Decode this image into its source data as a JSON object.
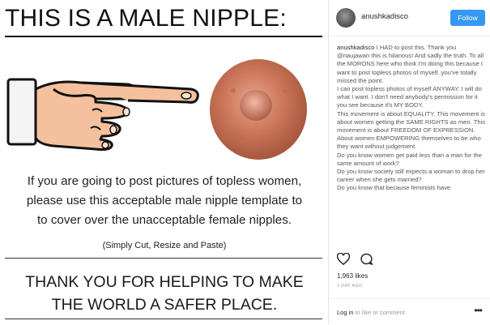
{
  "post_image": {
    "headline": "THIS IS A MALE NIPPLE:",
    "instructions": [
      "If you are going to post pictures of topless women,",
      "please use this acceptable male nipple template to",
      "to cover over the unacceptable female nipples."
    ],
    "subnote": "(Simply Cut, Resize and Paste)",
    "thanks": [
      "THANK YOU FOR HELPING TO MAKE",
      "THE WORLD A SAFER PLACE."
    ]
  },
  "header": {
    "username": "anushkadisco",
    "follow_label": "Follow"
  },
  "caption": {
    "username": "anushkadisco",
    "lines": [
      "I HAD to post this. Thank you @naujawan this is hilarious! And sadly the truth. To all the MORONS here who think I'm doing this because I want to post topless photos of myself..you've totally missed the point.",
      "I can post topless photos of myself ANYWAY. I will do what I want. I don't need anybody's permission for it you see because it's MY BODY.",
      "This movement is about EQUALITY. This movement is about women getting the SAME RIGHTS as men. This movement is about FREEDOM OF EXPRESSION.",
      "About women EMPOWERING themselves to be who they want without judgement.",
      "Do you know women get paid less than a man for the same amount of work?",
      "Do you know society still expects a woman to drop her career when she gets married?",
      "Do you know that because feminists have"
    ]
  },
  "actions": {
    "like_icon": "heart-icon",
    "comment_icon": "comment-icon"
  },
  "likes": "1,963 likes",
  "timestamp": "1 DAY AGO",
  "comment_bar": {
    "login_text": "Log in",
    "rest_text": "to like or comment.",
    "more_icon": "more-options-icon"
  },
  "colors": {
    "follow_blue": "#3897f0",
    "text_dark": "#262626",
    "text_muted": "#999999"
  }
}
